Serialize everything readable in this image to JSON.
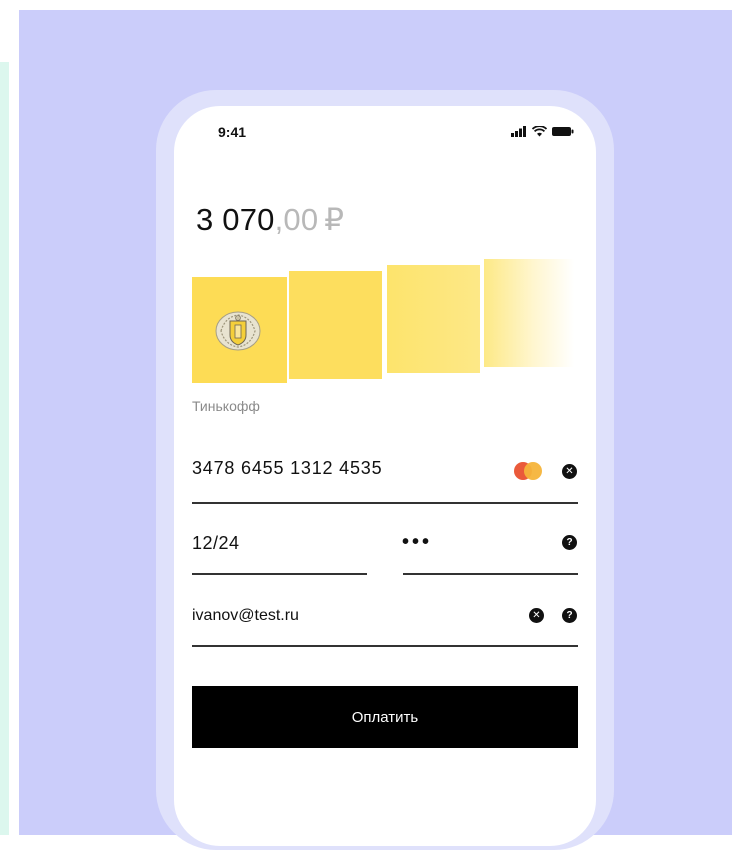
{
  "status_bar": {
    "time": "9:41"
  },
  "payment": {
    "amount_int": "3 070",
    "amount_dec": ",00",
    "currency": "₽"
  },
  "bank": {
    "name": "Тинькофф"
  },
  "form": {
    "card_number": "3478 6455 1312 4535",
    "expiry": "12/24",
    "cvv_masked": "•••",
    "email": "ivanov@test.ru",
    "pay_label": "Оплатить"
  },
  "icons": {
    "card_brand": "mastercard-icon",
    "clear": "close-circle-icon",
    "help": "question-circle-icon"
  },
  "colors": {
    "background": "#cbcdfa",
    "tile_yellow": "#fddc55",
    "button": "#000000"
  }
}
